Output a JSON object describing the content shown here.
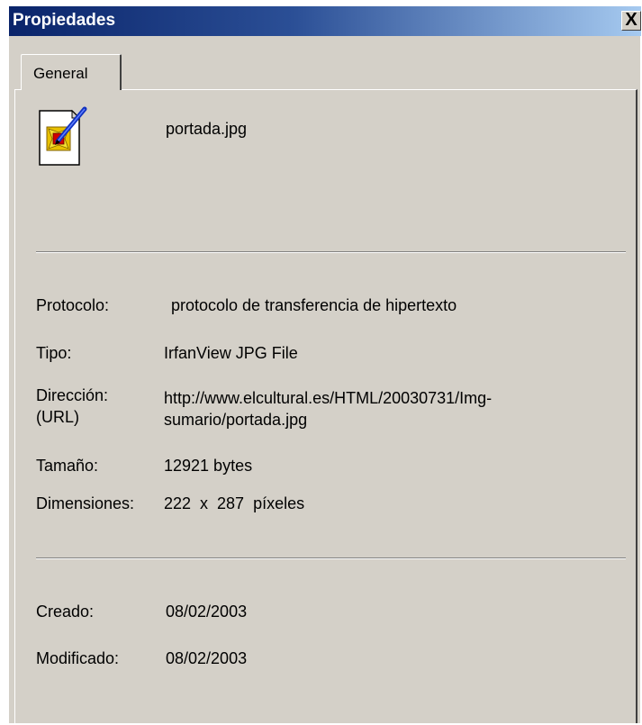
{
  "window": {
    "title": "Propiedades",
    "close_glyph": "X",
    "close_icon": "close-icon"
  },
  "tabs": [
    {
      "label": "General",
      "selected": true
    }
  ],
  "file": {
    "icon": "irfanview-jpg-file-icon",
    "name": "portada.jpg"
  },
  "properties": {
    "protocolo": {
      "label": "Protocolo:",
      "value": "protocolo de transferencia de hipertexto"
    },
    "tipo": {
      "label": "Tipo:",
      "value": "IrfanView JPG File"
    },
    "direccion": {
      "label_line1": "Dirección:",
      "label_line2": "(URL)",
      "value_line1": "http://www.elcultural.es/HTML/20030731/Img-",
      "value_line2": "sumario/portada.jpg"
    },
    "tamano": {
      "label": "Tamaño:",
      "value": "12921 bytes"
    },
    "dimensiones": {
      "label": "Dimensiones:",
      "value": "222  x  287  píxeles"
    }
  },
  "dates": {
    "creado": {
      "label": "Creado:",
      "value": "08/02/2003"
    },
    "modificado": {
      "label": "Modificado:",
      "value": "08/02/2003"
    }
  },
  "colors": {
    "title_gradient_start": "#0a246a",
    "title_gradient_end": "#a6caf0",
    "dialog_face": "#d4d0c8"
  }
}
